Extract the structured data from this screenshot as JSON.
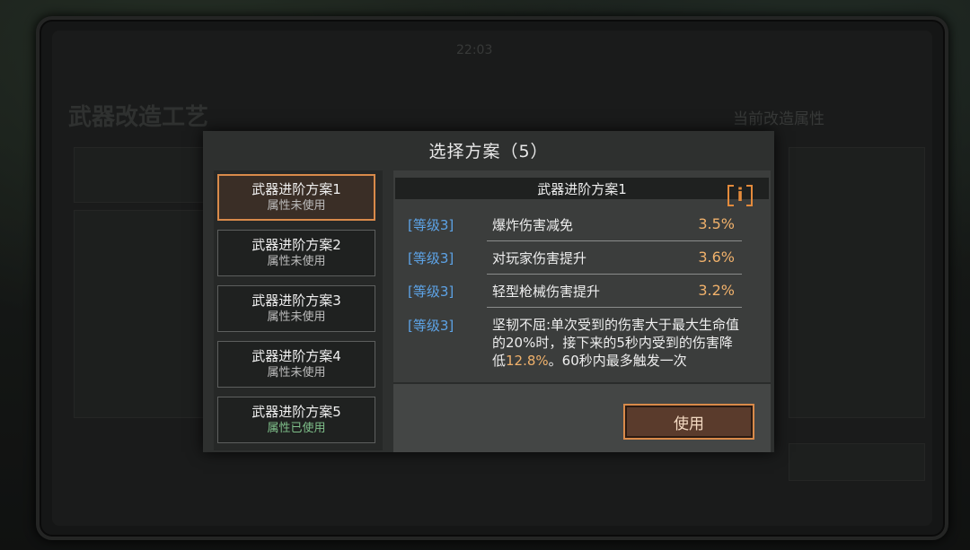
{
  "background": {
    "title": "武器改造工艺",
    "header_center": "22:03",
    "right_title": "当前改造属性"
  },
  "modal": {
    "title": "选择方案（5）",
    "plans": [
      {
        "name": "武器进阶方案1",
        "status": "属性未使用"
      },
      {
        "name": "武器进阶方案2",
        "status": "属性未使用"
      },
      {
        "name": "武器进阶方案3",
        "status": "属性未使用"
      },
      {
        "name": "武器进阶方案4",
        "status": "属性未使用"
      },
      {
        "name": "武器进阶方案5",
        "status": "属性已使用"
      }
    ],
    "selected_plan": 1,
    "detail": {
      "title": "武器进阶方案1",
      "info_glyph": "i",
      "attributes": [
        {
          "level": "[等级3]",
          "name": "爆炸伤害减免",
          "value": "3.5%"
        },
        {
          "level": "[等级3]",
          "name": "对玩家伤害提升",
          "value": "3.6%"
        },
        {
          "level": "[等级3]",
          "name": "轻型枪械伤害提升",
          "value": "3.2%"
        }
      ],
      "special": {
        "level": "[等级3]",
        "text_1": "坚韧不屈:单次受到的伤害大于最大生命值的20%时，接下来的5秒内受到的伤害降低",
        "highlight": "12.8%",
        "text_2": "。60秒内最多触发一次"
      },
      "use_button": "使用"
    }
  },
  "colors": {
    "accent": "#d98a4a",
    "level_blue": "#5da3e6",
    "value_orange": "#f0b16b",
    "used_green": "#7fc08a"
  }
}
